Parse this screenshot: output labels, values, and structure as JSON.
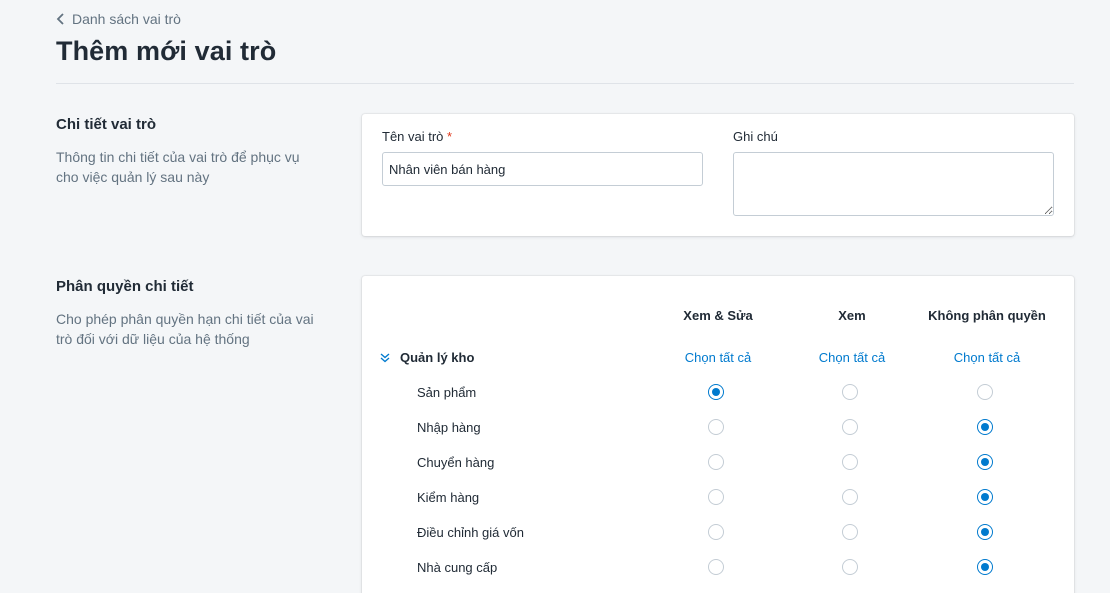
{
  "breadcrumb": {
    "label": "Danh sách vai trò"
  },
  "page": {
    "title": "Thêm mới vai trò"
  },
  "details_section": {
    "title": "Chi tiết vai trò",
    "description": "Thông tin chi tiết của vai trò để phục vụ cho việc quản lý sau này",
    "name_field": {
      "label": "Tên vai trò",
      "required_mark": "*",
      "value": "Nhân viên bán hàng"
    },
    "note_field": {
      "label": "Ghi chú",
      "value": ""
    }
  },
  "permissions_section": {
    "title": "Phân quyền chi tiết",
    "description": "Cho phép phân quyền hạn chi tiết của vai trò đối với dữ liệu của hệ thống",
    "columns": [
      "Xem & Sửa",
      "Xem",
      "Không phân quyền"
    ],
    "group": {
      "label": "Quản lý kho",
      "icon": "double-chevron-down-icon",
      "select_all": [
        "Chọn tất cả",
        "Chọn tất cả",
        "Chọn tất cả"
      ]
    },
    "rows": [
      {
        "label": "Sản phẩm",
        "selected": 0
      },
      {
        "label": "Nhập hàng",
        "selected": 2
      },
      {
        "label": "Chuyển hàng",
        "selected": 2
      },
      {
        "label": "Kiểm hàng",
        "selected": 2
      },
      {
        "label": "Điều chỉnh giá vốn",
        "selected": 2
      },
      {
        "label": "Nhà cung cấp",
        "selected": 2
      }
    ]
  },
  "colors": {
    "accent": "#007ace",
    "required": "#de3618",
    "background": "#f4f6f8"
  }
}
